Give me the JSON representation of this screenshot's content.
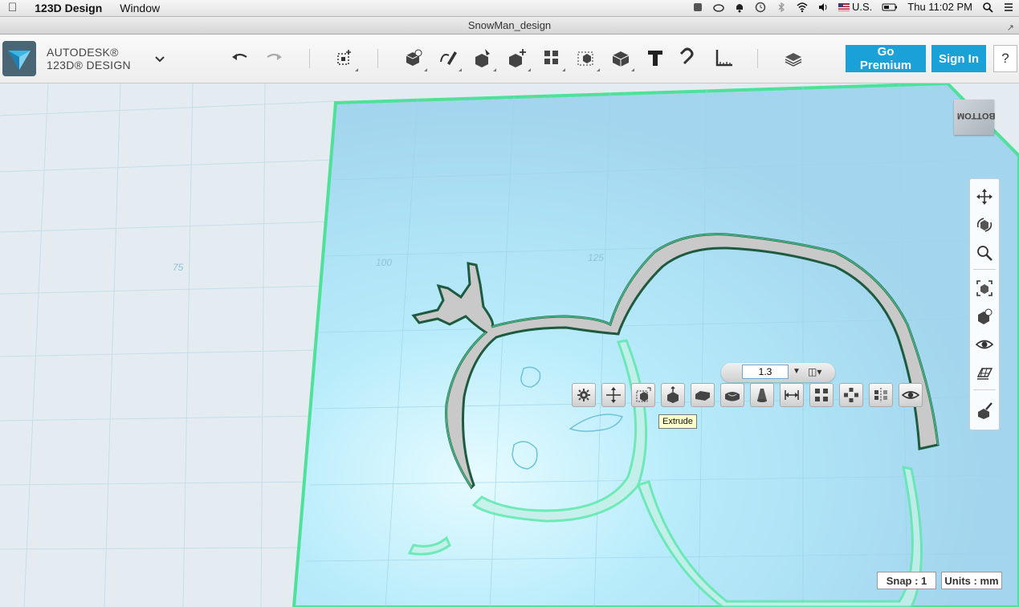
{
  "menubar": {
    "app_name": "123D Design",
    "window_menu": "Window",
    "input_source": "U.S.",
    "clock": "Thu 11:02 PM"
  },
  "window": {
    "title": "SnowMan_design"
  },
  "brand": {
    "line1": "AUTODESK®",
    "line2": "123D® DESIGN"
  },
  "toolbar": {
    "go_premium": "Go Premium",
    "sign_in": "Sign In",
    "help": "?"
  },
  "viewport": {
    "grid_labels": [
      "75",
      "100",
      "125"
    ],
    "viewcube_face": "BOTTOM"
  },
  "dimension": {
    "value": "1.3"
  },
  "tooltip": {
    "text": "Extrude"
  },
  "status": {
    "snap": "Snap : 1",
    "units": "Units : mm"
  },
  "colors": {
    "accent": "#1aa1d8",
    "plane": "#a9dbf2",
    "plane_edge": "#4fe09a",
    "sketch_fill": "#c9c9c9",
    "sketch_edge": "#1e5a3f"
  }
}
